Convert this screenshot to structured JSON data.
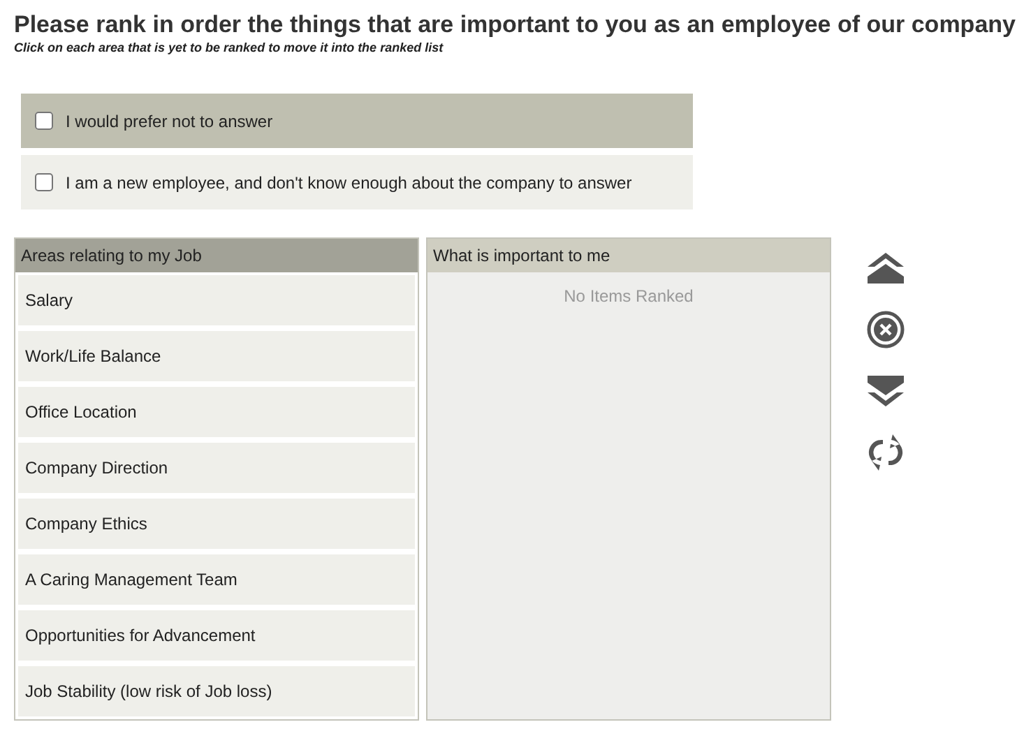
{
  "title": "Please rank in order the things that are important to you as an employee of our company",
  "subtitle": "Click on each area that is yet to be ranked to move it into the ranked list",
  "options": [
    {
      "label": "I would prefer not to answer",
      "checked": false,
      "highlighted": true
    },
    {
      "label": "I am a new employee, and don't know enough about the company to answer",
      "checked": false,
      "highlighted": false
    }
  ],
  "areas": {
    "heading": "Areas relating to my Job",
    "items": [
      "Salary",
      "Work/Life Balance",
      "Office Location",
      "Company Direction",
      "Company Ethics",
      "A Caring Management Team",
      "Opportunities for Advancement",
      "Job Stability (low risk of Job loss)"
    ]
  },
  "ranked": {
    "heading": "What is important to me",
    "empty_text": "No Items Ranked"
  },
  "tools": [
    {
      "kind": "top"
    },
    {
      "kind": "remove"
    },
    {
      "kind": "bottom"
    },
    {
      "kind": "reset"
    }
  ]
}
